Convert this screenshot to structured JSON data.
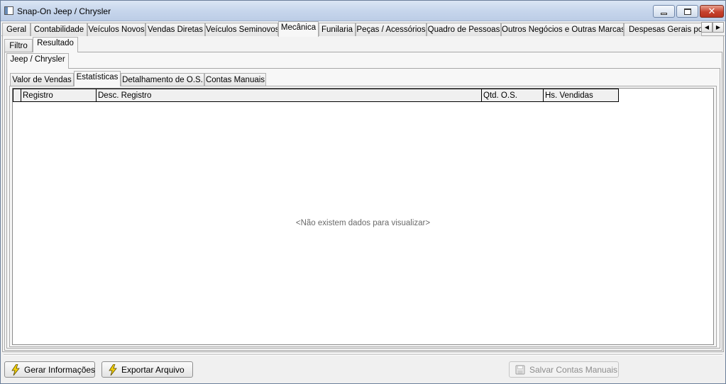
{
  "window": {
    "title": "Snap-On Jeep / Chrysler",
    "icon": "app-window-icon",
    "controls": {
      "minimize": "minimize-icon",
      "maximize": "maximize-icon",
      "close": "close-icon"
    }
  },
  "main_tabs": [
    {
      "label": "Geral"
    },
    {
      "label": "Contabilidade"
    },
    {
      "label": "Veículos Novos"
    },
    {
      "label": "Vendas Diretas"
    },
    {
      "label": "Veículos Seminovos"
    },
    {
      "label": "Mecânica",
      "active": true
    },
    {
      "label": "Funilaria"
    },
    {
      "label": "Peças / Acessórios"
    },
    {
      "label": "Quadro de Pessoas"
    },
    {
      "label": "Outros Negócios e Outras Marcas"
    },
    {
      "label": "Despesas Gerais por D"
    }
  ],
  "tab_scroll": {
    "left": "◀",
    "right": "▶"
  },
  "sub_tabs": [
    {
      "label": "Filtro"
    },
    {
      "label": "Resultado",
      "active": true
    }
  ],
  "brand_tabs": [
    {
      "label": "Jeep / Chrysler",
      "active": true
    }
  ],
  "section_tabs": [
    {
      "label": "Valor de Vendas"
    },
    {
      "label": "Estatísticas",
      "active": true
    },
    {
      "label": "Detalhamento de O.S."
    },
    {
      "label": "Contas Manuais"
    }
  ],
  "grid": {
    "columns": [
      "Registro",
      "Desc. Registro",
      "Qtd. O.S.",
      "Hs. Vendidas"
    ],
    "empty_message": "<Não existem dados para visualizar>"
  },
  "footer": {
    "generate": {
      "label": "Gerar Informações",
      "icon": "lightning-icon"
    },
    "export": {
      "label": "Exportar Arquivo",
      "icon": "lightning-icon"
    },
    "save": {
      "label": "Salvar Contas Manuais",
      "icon": "save-disk-icon",
      "enabled": false
    }
  },
  "colors": {
    "titlebar": "#c7d6ec",
    "close_button": "#c6412d",
    "bolt": "#f5d20a",
    "empty_text": "#6a6a6a"
  }
}
